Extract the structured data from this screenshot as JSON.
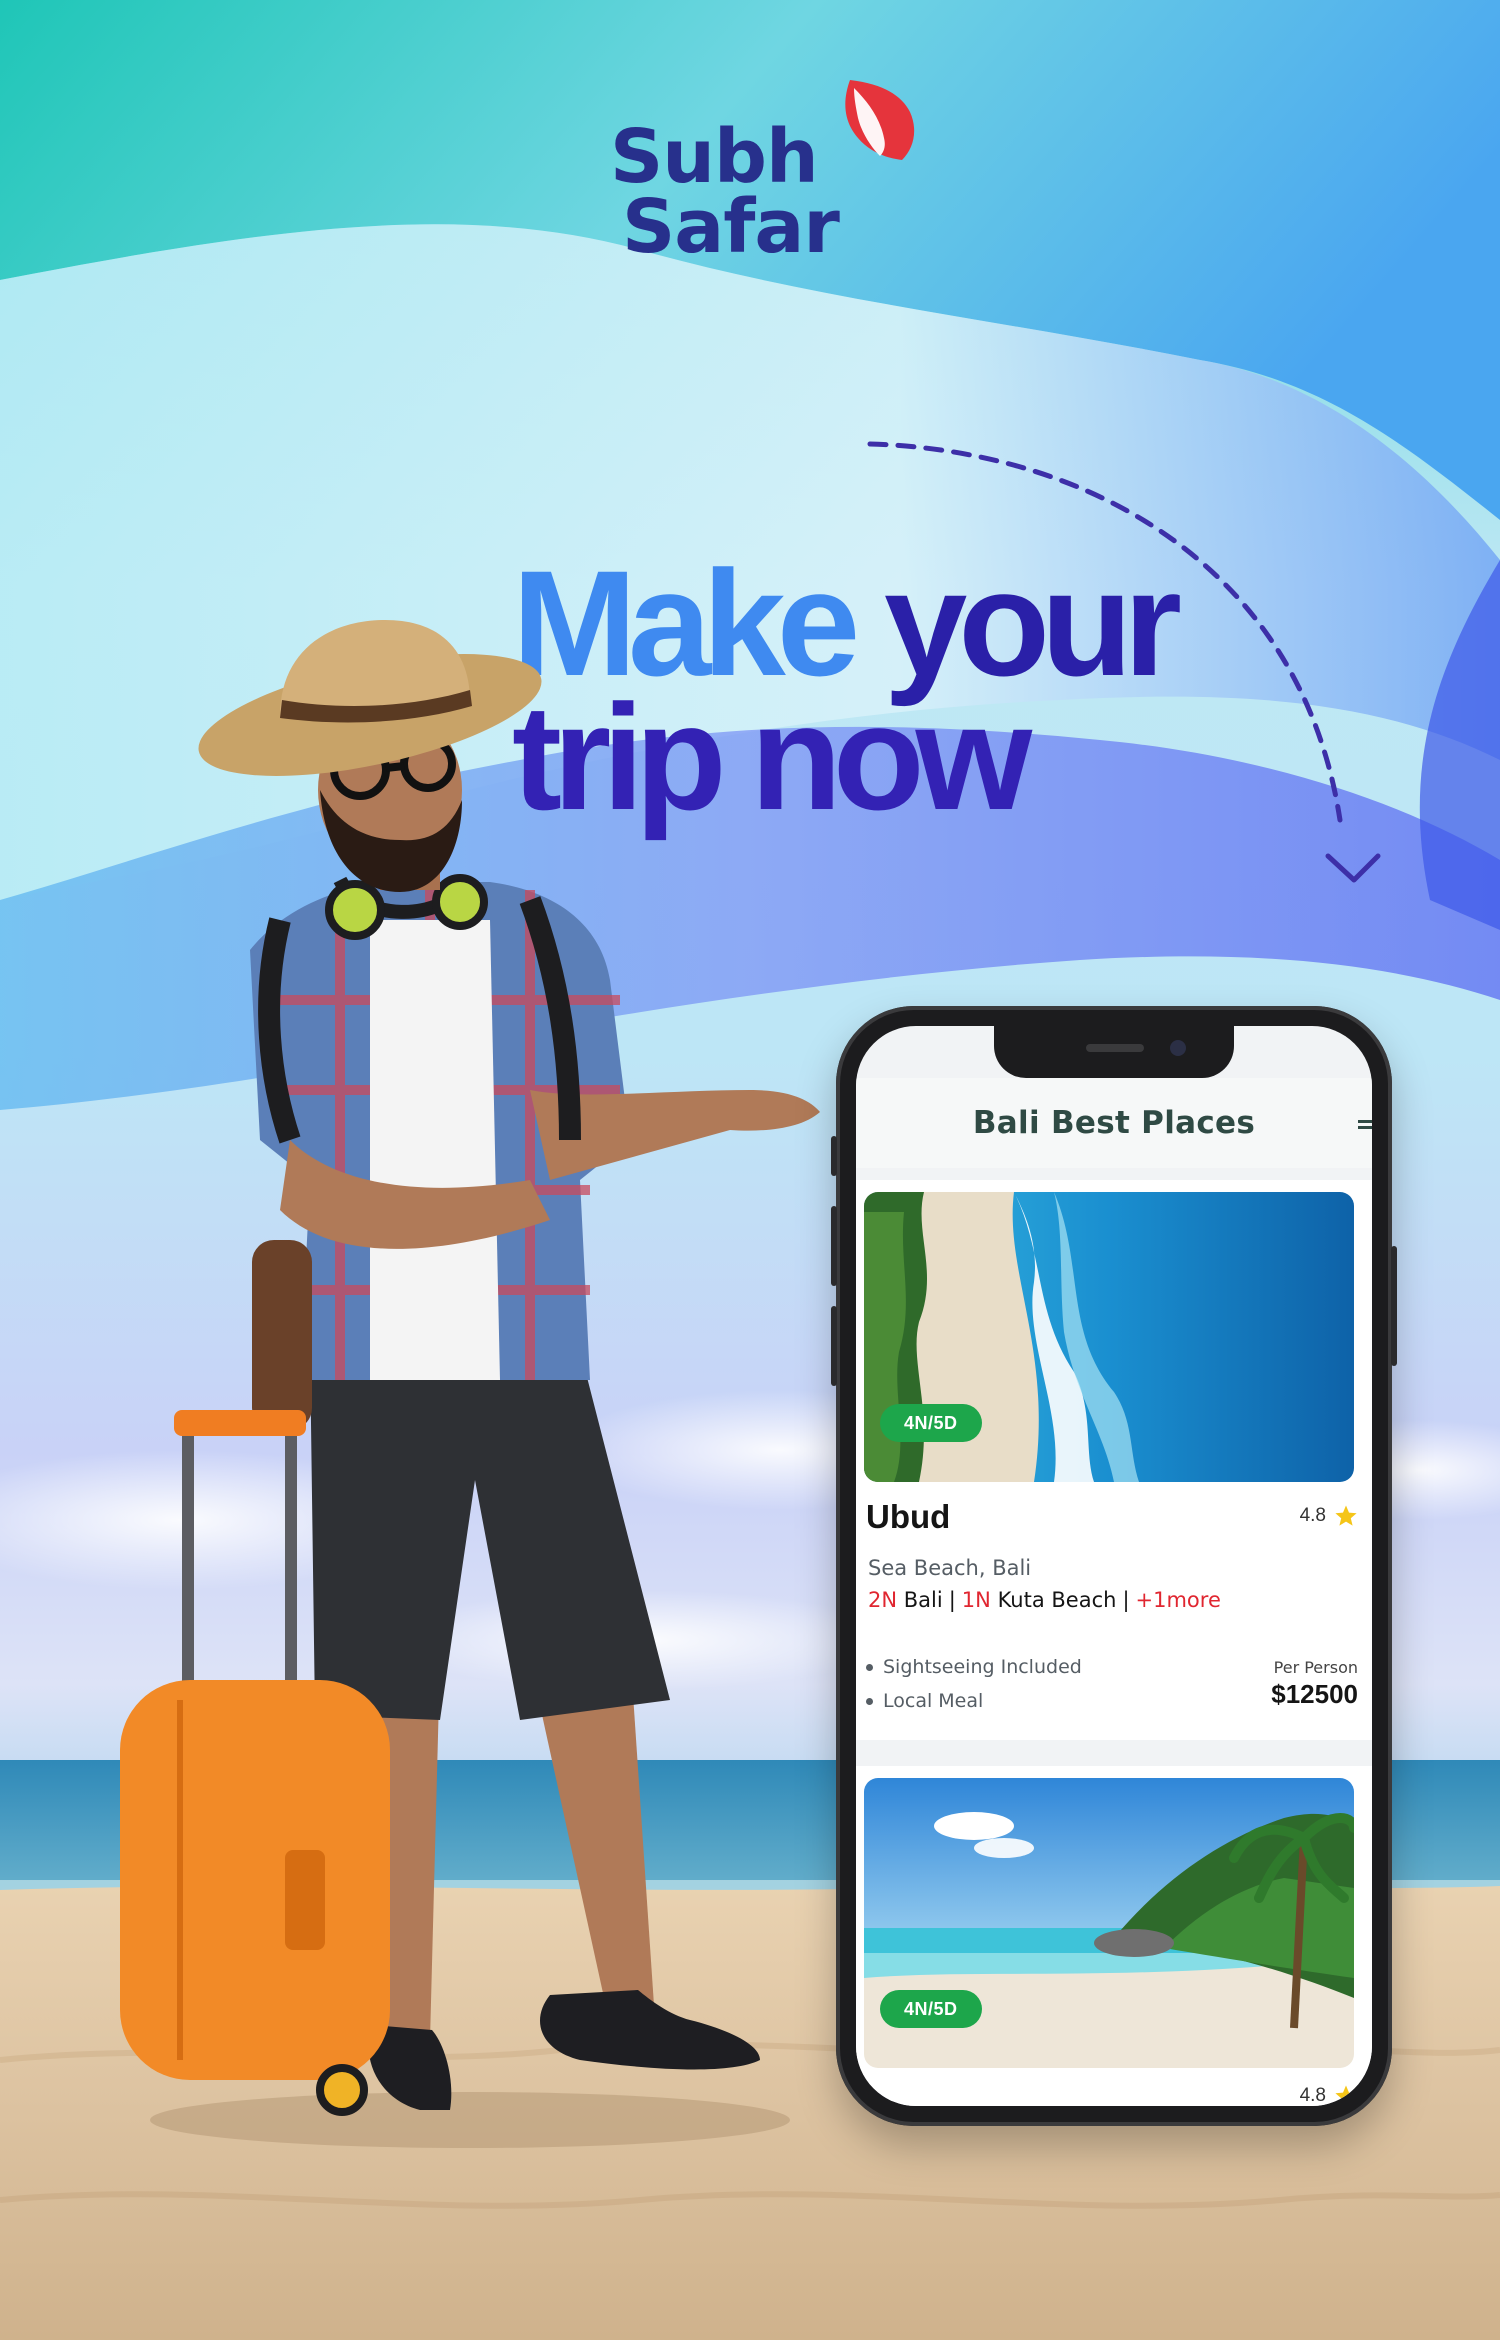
{
  "brand": {
    "line1": "Subh",
    "line2": "Safar",
    "primary_color": "#27308c",
    "accent_color": "#e5343c"
  },
  "headline": {
    "word1": "Make",
    "word2": "your",
    "line2": "trip now",
    "color_light": "#3f8af0",
    "color_dark": "#2a20a8"
  },
  "app": {
    "title": "Bali Best Places",
    "cards": [
      {
        "duration": "4N/5D",
        "name": "Ubud",
        "rating": "4.8",
        "location": "Sea Beach, Bali",
        "itinerary": [
          {
            "nights": "2N",
            "place": "Bali"
          },
          {
            "nights": "1N",
            "place": "Kuta Beach"
          }
        ],
        "more": "+1more",
        "features": [
          "Sightseeing Included",
          "Local Meal"
        ],
        "price_label": "Per Person",
        "price": "$12500"
      },
      {
        "duration": "4N/5D",
        "rating": "4.8"
      }
    ]
  },
  "icons": [
    "brand-bird-icon",
    "star-icon",
    "menu-icon",
    "dashed-arrow-icon"
  ],
  "badge_color": "#1da64b"
}
